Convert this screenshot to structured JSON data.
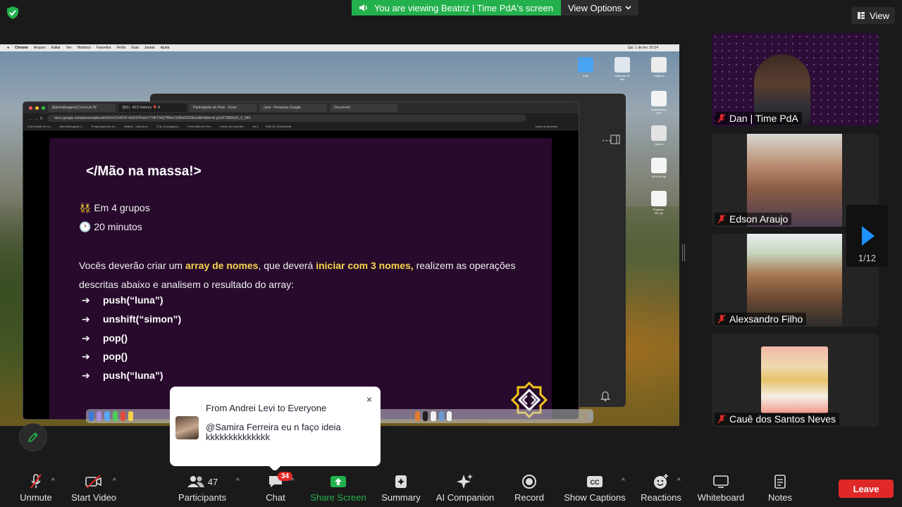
{
  "top": {
    "banner_text": "You are viewing Beatriz | Time PdA's screen",
    "view_options": "View Options",
    "view_button": "View"
  },
  "shared": {
    "menubar_items": [
      "Chrome",
      "Arquivo",
      "Editar",
      "Ver",
      "Histórico",
      "Favoritos",
      "Perfis",
      "Guia",
      "Janela",
      "Ajuda"
    ],
    "clock": "Qui. 1 de fev. 20:34",
    "tabs": [
      "[Aprendizagem] Currículo W",
      "[M1] - A19 Vetores 🎈 A",
      "Participante do Post - Zoom",
      "case - Pesquisa Google",
      "Document"
    ],
    "url": "docs.google.com/presentation/d/1lOmUVx6OF-AnO1P6nbCY7l4rTStQTff6oCS08ctDDGE/edit#slide=id.g1e873f82b20_0_580",
    "bookmarks": [
      "[T4] Gestão de tur...",
      "[Aprendizagem] C...",
      "Programadores do...",
      "Beatriz - Canvas d...",
      "[T4] Cronograma...",
      "Formulário de Fee...",
      "Check de LinkedIn...",
      "rfe-a",
      "NLW IA | Rocketseat",
      "Todos os favoritos"
    ],
    "desktop_icons": [
      "Aula",
      "Capturas de tela",
      "Imagens",
      "Documentos PDF",
      "Outros",
      "A19-M1.zip",
      "Projetos-M1.zip"
    ],
    "slide": {
      "title": "</Mão na massa!>",
      "line1": "👯 Em 4 grupos",
      "line2": "🕐 20 minutos",
      "body_pre": "Vocês deverão criar um ",
      "body_hl1": "array de nomes",
      "body_mid": ", que deverá ",
      "body_hl2": "iniciar com 3 nomes,",
      "body_post": " realizem as operações descritas abaixo e analisem o resultado do array:",
      "arrow": "➔",
      "items": [
        "push(“luna”)",
        "unshift(“simon”)",
        "pop()",
        "pop()",
        "push(“luna”)"
      ]
    }
  },
  "toast": {
    "from": "From Andrei Levi to Everyone",
    "message": "@Samira Ferreira eu n faço ideia kkkkkkkkkkkkkk",
    "close": "×"
  },
  "participants": [
    {
      "name": "Dan | Time PdA"
    },
    {
      "name": "Edson Araujo"
    },
    {
      "name": "Alexsandro Filho"
    },
    {
      "name": "Cauê dos Santos Neves"
    }
  ],
  "pager": {
    "text": "1/12"
  },
  "toolbar": {
    "unmute": "Unmute",
    "start_video": "Start Video",
    "participants": "Participants",
    "participants_count": "47",
    "chat": "Chat",
    "chat_badge": "34",
    "share_screen": "Share Screen",
    "summary": "Summary",
    "ai_companion": "AI Companion",
    "record": "Record",
    "show_captions": "Show Captions",
    "reactions": "Reactions",
    "whiteboard": "Whiteboard",
    "notes": "Notes",
    "leave": "Leave"
  },
  "colors": {
    "share_green": "#23b14d",
    "leave_red": "#e02828",
    "slide_bg": "#270a2c",
    "highlight": "#f8d74a",
    "pager_blue": "#1e90ff"
  }
}
